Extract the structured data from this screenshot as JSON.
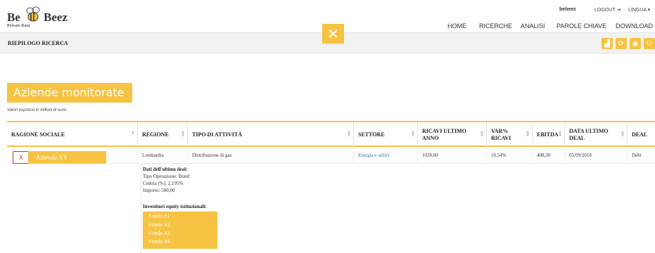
{
  "header": {
    "logo": {
      "word1": "Be",
      "word2": "Beez",
      "subtitle": "Private Data"
    },
    "user": "bebeez",
    "logout": "LOGOUT",
    "language": "LINGUA",
    "nav": [
      "HOME",
      "RICERCHE",
      "ANALISI",
      "PAROLE CHIAVE",
      "DOWNLOAD"
    ],
    "close_label": "✕"
  },
  "summary_bar": {
    "title": "RIEPILOGO RICERCA",
    "tools": [
      "chart-icon",
      "cycle-icon",
      "piggy-bank-icon",
      "network-icon"
    ]
  },
  "section": {
    "heading": "Aziende monitorate",
    "note": "Valori espressi in milioni di euro."
  },
  "table": {
    "columns": [
      "RAGIONE SOCIALE",
      "REGIONE",
      "TIPO DI ATTIVITÀ",
      "SETTORE",
      "RICAVI ULTIMO ANNO",
      "VAR% RICAVI",
      "EBITDA",
      "DATA ULTIMO DEAL",
      "DEAL"
    ],
    "rows": [
      {
        "delete_label": "X",
        "company": "Azienda XY",
        "regione": "Lombardia",
        "tipo_attivita": "Distribuzione di gas",
        "settore": "Energia e utility",
        "ricavi": "1028,00",
        "var_ricavi": "10,54%",
        "ebitda": "408,30",
        "data_deal": "05/09/2018",
        "deal": "Debt"
      }
    ],
    "detail": {
      "deal_title": "Dati dell'ultimo deal:",
      "deal_lines": [
        "Tipo Operazione: Bond",
        "Cedola (%): 2,195%",
        "Importo: 500,00"
      ],
      "investors_title": "Investitori equity istituzionali:",
      "funds": [
        "Fondo #1",
        "Fondo #2",
        "Fondo #3",
        "Fondo #4"
      ]
    }
  },
  "colors": {
    "accent": "#f6c342",
    "link": "#3b6fb6",
    "danger": "#cc3333"
  }
}
